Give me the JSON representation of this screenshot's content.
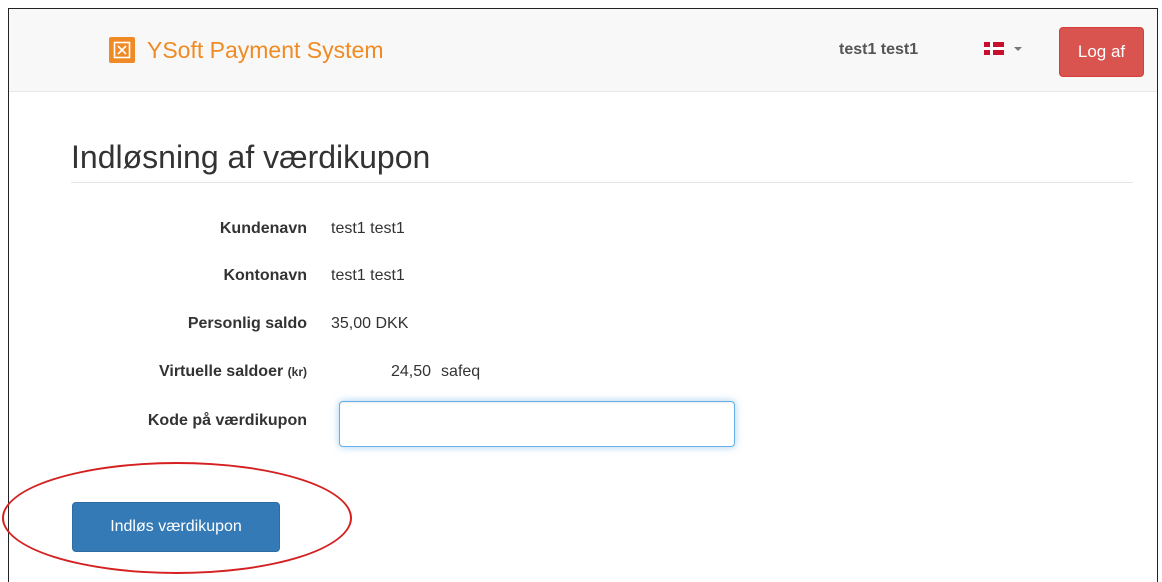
{
  "header": {
    "brand_title": "YSoft Payment System",
    "user_name": "test1 test1",
    "language_flag": "flag-denmark-icon",
    "logout_label": "Log af"
  },
  "page": {
    "title": "Indløsning af værdikupon"
  },
  "details": {
    "customer_name_label": "Kundenavn",
    "customer_name_value": "test1 test1",
    "account_name_label": "Kontonavn",
    "account_name_value": "test1 test1",
    "personal_balance_label": "Personlig saldo",
    "personal_balance_value": "35,00 DKK",
    "virtual_balances_label": "Virtuelle saldoer",
    "virtual_balances_unit": "(kr)",
    "virtual_balance_amount": "24,50",
    "virtual_balance_name": "safeq",
    "voucher_code_label": "Kode på værdikupon",
    "voucher_code_value": ""
  },
  "actions": {
    "redeem_label": "Indløs værdikupon"
  },
  "colors": {
    "brand": "#f08a24",
    "danger": "#d9534f",
    "primary": "#337ab7",
    "annotation": "#d42020"
  }
}
